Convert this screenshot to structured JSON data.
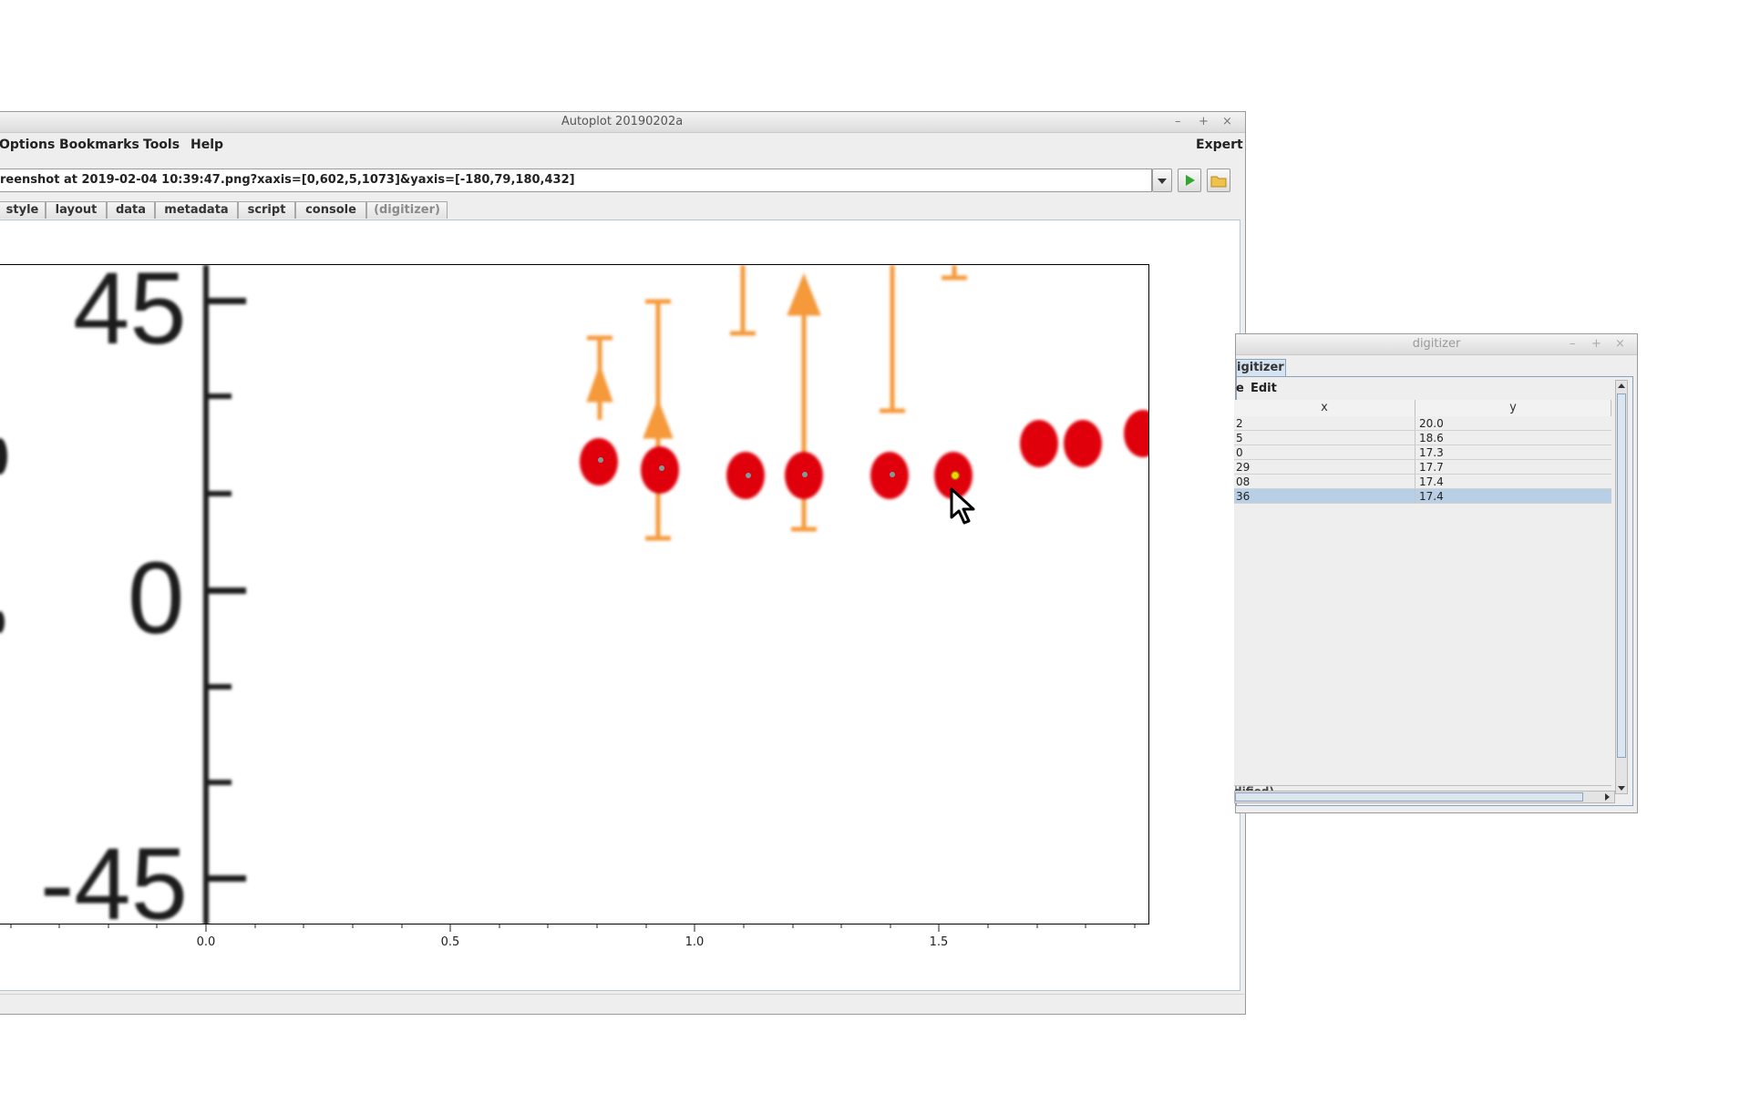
{
  "main_window": {
    "title": "Autoplot 20190202a",
    "controls": [
      "–",
      "+",
      "×"
    ],
    "menu": [
      "Options",
      "Bookmarks",
      "Tools",
      "Help"
    ],
    "expert_label": "Expert",
    "url": "reenshot at 2019-02-04 10:39:47.png?xaxis=[0,602,5,1073]&yaxis=[-180,79,180,432]",
    "tabs": [
      "style",
      "layout",
      "data",
      "metadata",
      "script",
      "console",
      "(digitizer)"
    ],
    "plot": {
      "image_labels": [
        "45",
        "0",
        "-45"
      ],
      "x_tick_labels": [
        "0.0",
        "0.5",
        "1.0",
        "1.5"
      ]
    }
  },
  "chart_data": {
    "type": "scatter",
    "x_tick_labels": [
      "0.0",
      "0.5",
      "1.0",
      "1.5"
    ],
    "y_image_labels": [
      "45",
      "0",
      "-45"
    ],
    "digitized_points_shown": 6,
    "grid": false
  },
  "digitizer_window": {
    "title": "digitizer",
    "controls": [
      "–",
      "+",
      "×"
    ],
    "tab_label": "igitizer",
    "menu": [
      "e",
      "Edit"
    ],
    "columns": [
      "x",
      "y"
    ],
    "rows": [
      {
        "x": "2",
        "y": "20.0"
      },
      {
        "x": "5",
        "y": "18.6"
      },
      {
        "x": "0",
        "y": "17.3"
      },
      {
        "x": "29",
        "y": "17.7"
      },
      {
        "x": "08",
        "y": "17.4"
      },
      {
        "x": "36",
        "y": "17.4"
      }
    ],
    "selected_row": 5,
    "status_text": "dified)"
  },
  "colors": {
    "red_dot": "#e0000b",
    "orange_bar": "#f5993a",
    "selection": "#b8cfe5",
    "tab_border": "#b6c6d6"
  }
}
